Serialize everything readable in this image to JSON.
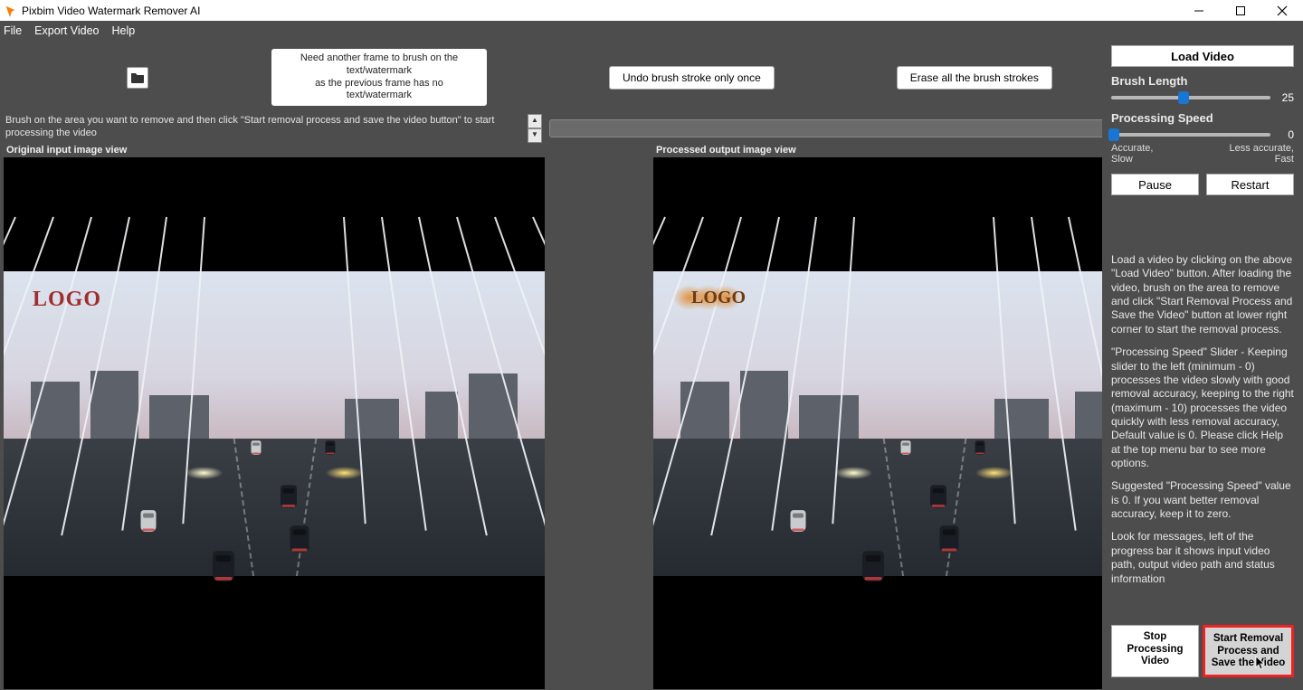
{
  "window": {
    "title": "Pixbim Video Watermark Remover AI"
  },
  "menu": {
    "file": "File",
    "export": "Export Video",
    "help": "Help"
  },
  "toolbar": {
    "hint_l1": "Need another frame to brush on the text/watermark",
    "hint_l2": "as the previous frame has no text/watermark",
    "undo": "Undo brush stroke only once",
    "erase": "Erase all the brush strokes"
  },
  "info_text": "Brush on the area you want to remove and then click \"Start removal process and save the video button\" to start processing the video",
  "views": {
    "left_title": "Original input image view",
    "right_title": "Processed output image view",
    "watermark_text": "LOGO",
    "brush_text": "LOGO"
  },
  "right": {
    "load_video": "Load Video",
    "brush_length_label": "Brush Length",
    "brush_length_value": "25",
    "proc_speed_label": "Processing Speed",
    "proc_speed_value": "0",
    "accurate_slow": "Accurate, Slow",
    "less_accurate_fast": "Less accurate, Fast",
    "pause": "Pause",
    "restart": "Restart",
    "help_p1": "Load a video by clicking on the above \"Load Video\" button.",
    "help_p2": "After loading the video, brush on the area to remove and click \"Start Removal Process and Save the Video\" button at lower right corner to start the removal process.",
    "help_p3": "\"Processing Speed\" Slider - Keeping slider to the left (minimum - 0) processes the video slowly with good removal accuracy, keeping to the right (maximum - 10) processes the video quickly with less removal accuracy, Default value is 0. Please click Help at the top menu bar to see more options.",
    "help_p4": "Suggested \"Processing Speed\" value is 0. If you want better removal accuracy, keep it to zero.",
    "help_p5": "Look for messages, left of the progress bar it shows input video path, output video path and status information",
    "stop_btn": "Stop Processing Video",
    "start_btn": "Start Removal Process and Save the Video"
  }
}
